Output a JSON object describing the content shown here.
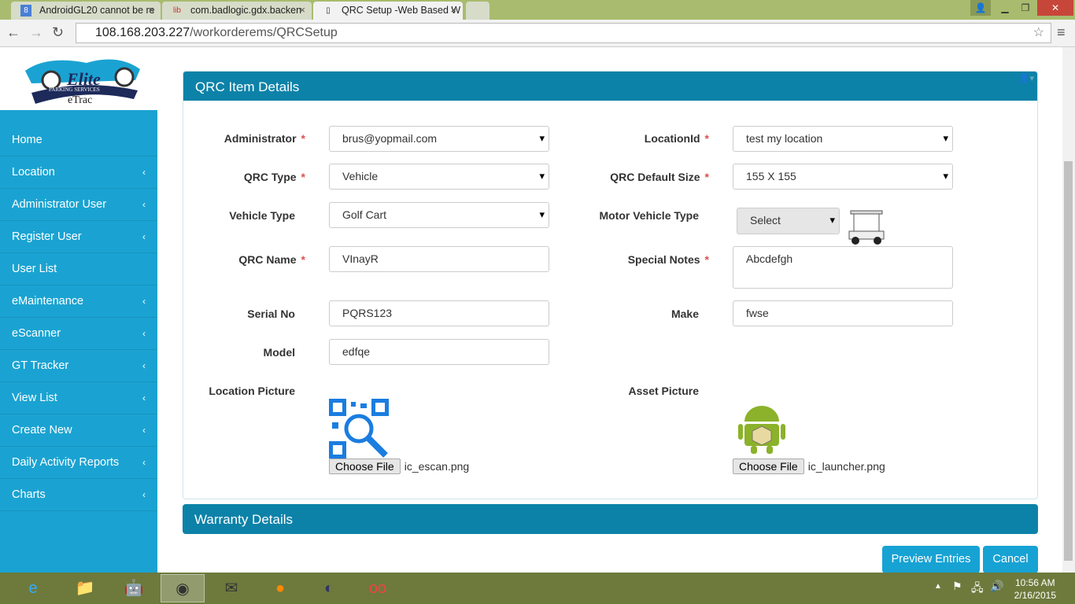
{
  "browser": {
    "tabs": [
      {
        "title": "AndroidGL20 cannot be re",
        "icon": "google-icon"
      },
      {
        "title": "com.badlogic.gdx.backen",
        "icon": "libgdx-icon"
      },
      {
        "title": "QRC Setup -Web Based W",
        "icon": "page-icon"
      }
    ],
    "url_host": "108.168.203.227",
    "url_path": "/workorderems/QRCSetup"
  },
  "logo": {
    "brand": "Elite",
    "tagline": "PARKING SERVICES",
    "product": "eTrac"
  },
  "sidebar": {
    "items": [
      {
        "label": "Home",
        "chevron": false
      },
      {
        "label": "Location",
        "chevron": true
      },
      {
        "label": "Administrator User",
        "chevron": true
      },
      {
        "label": "Register User",
        "chevron": true
      },
      {
        "label": "User List",
        "chevron": false
      },
      {
        "label": "eMaintenance",
        "chevron": true
      },
      {
        "label": "eScanner",
        "chevron": true
      },
      {
        "label": "GT Tracker",
        "chevron": true
      },
      {
        "label": "View List",
        "chevron": true
      },
      {
        "label": "Create New",
        "chevron": true
      },
      {
        "label": "Daily Activity Reports",
        "chevron": true
      },
      {
        "label": "Charts",
        "chevron": true
      }
    ]
  },
  "panel": {
    "title": "QRC Item Details"
  },
  "form": {
    "administrator": {
      "label": "Administrator",
      "value": "brus@yopmail.com"
    },
    "location_id": {
      "label": "LocationId",
      "value": "test my location"
    },
    "qrc_type": {
      "label": "QRC Type",
      "value": "Vehicle"
    },
    "qrc_default_size": {
      "label": "QRC Default Size",
      "value": "155 X 155"
    },
    "vehicle_type": {
      "label": "Vehicle Type",
      "value": "Golf Cart"
    },
    "motor_vehicle_type": {
      "label": "Motor Vehicle Type",
      "value": "Select"
    },
    "qrc_name": {
      "label": "QRC Name",
      "value": "VInayR"
    },
    "special_notes": {
      "label": "Special Notes",
      "value": "Abcdefgh"
    },
    "serial_no": {
      "label": "Serial No",
      "value": "PQRS123"
    },
    "make": {
      "label": "Make",
      "value": "fwse"
    },
    "model": {
      "label": "Model",
      "value": "edfqe"
    },
    "location_picture": {
      "label": "Location Picture",
      "button": "Choose File",
      "file": "ic_escan.png"
    },
    "asset_picture": {
      "label": "Asset Picture",
      "button": "Choose File",
      "file": "ic_launcher.png"
    },
    "required_mark": "*"
  },
  "warranty": {
    "title": "Warranty Details"
  },
  "actions": {
    "preview": "Preview Entries",
    "cancel": "Cancel"
  },
  "taskbar": {
    "time": "10:56 AM",
    "date": "2/16/2015"
  },
  "colors": {
    "sidebar": "#1aa3d2",
    "panel_header": "#0d82a8",
    "button": "#17a2d4"
  }
}
